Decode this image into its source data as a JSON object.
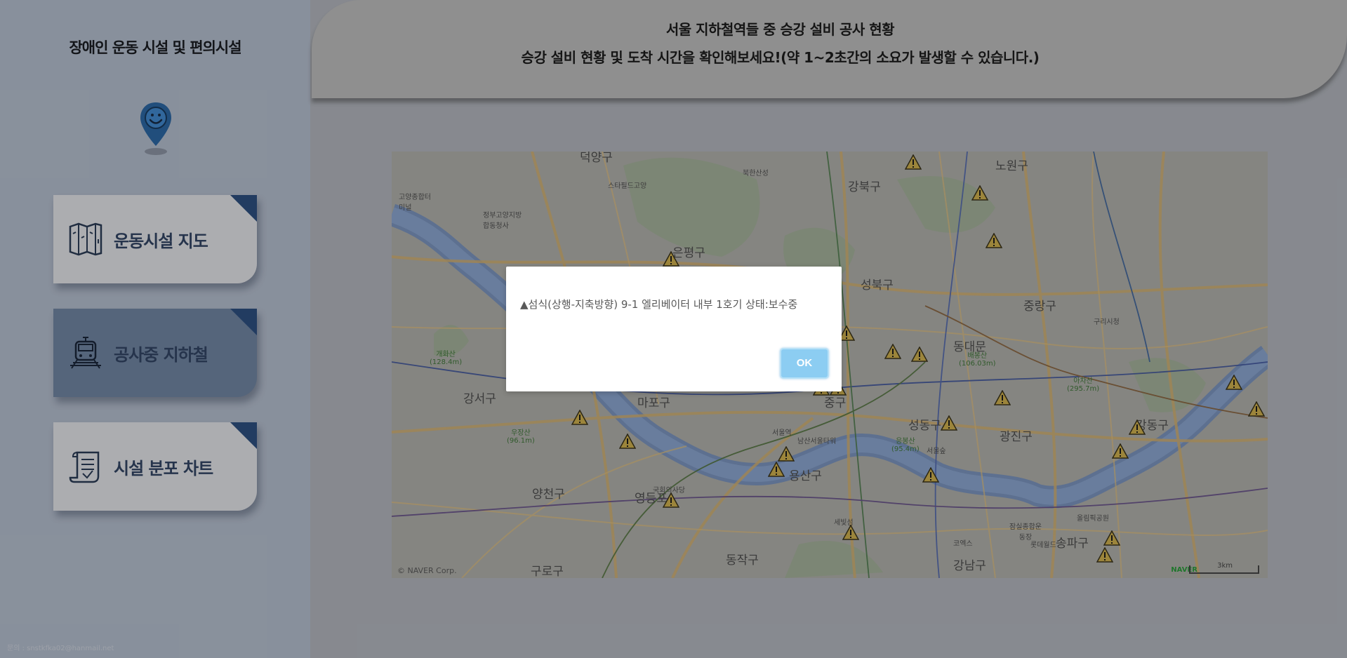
{
  "sidebar": {
    "title": "장애인 운동 시설 및 편의시설",
    "logo_icon": "smiley-map-pin-icon",
    "menu": [
      {
        "label": "운동시설 지도",
        "icon": "folded-map-icon",
        "state": "inactive"
      },
      {
        "label": "공사중 지하철",
        "icon": "subway-train-icon",
        "state": "active"
      },
      {
        "label": "시설 분포 차트",
        "icon": "scroll-document-icon",
        "state": "inactive"
      }
    ],
    "footer": "문의 : snstkfka02@hanmail.net"
  },
  "header": {
    "line1": "서울 지하철역들 중 승강 설비 공사 현황",
    "line2": "승강 설비 현황 및 도착 시간을 확인해보세요!(약 1~2초간의 소요가 발생할 수 있습니다.)"
  },
  "map": {
    "copyright": "© NAVER Corp.",
    "brand": "NAVER",
    "scale": "3km",
    "district_labels": [
      "은평구",
      "강북구",
      "노원구",
      "성북구",
      "동대문",
      "중랑구",
      "강서구",
      "마포구",
      "중구",
      "성동구",
      "광진구",
      "강동구",
      "양천구",
      "영등포",
      "용산구",
      "동작구",
      "구로구",
      "강남구",
      "송파구",
      "덕양구"
    ],
    "place_labels": [
      "서울역",
      "남산서울타워",
      "국회의사당",
      "코엑스",
      "롯데월드",
      "올림픽공원",
      "북한산성",
      "스타필드고양",
      "정부고양지방합동청사",
      "고양종합터미널",
      "구리시청",
      "세빛섬",
      "서울숲",
      "잠실종합운동장"
    ],
    "mountain_labels": [
      "개화산\n(128.4m)",
      "우장산\n(96.1m)",
      "배봉산\n(106.03m)",
      "아차산\n(295.7m)",
      "응봉산\n(95.4m)"
    ]
  },
  "dialog": {
    "message": "▲섬식(상행-지축방향) 9-1 엘리베이터 내부 1호기 상태:보수중",
    "ok_label": "OK"
  },
  "colors": {
    "active_menu": "#56687f",
    "inactive_menu": "#b5b6b9",
    "corner": "#1f3b63",
    "ok_button": "#8ccdf2"
  }
}
